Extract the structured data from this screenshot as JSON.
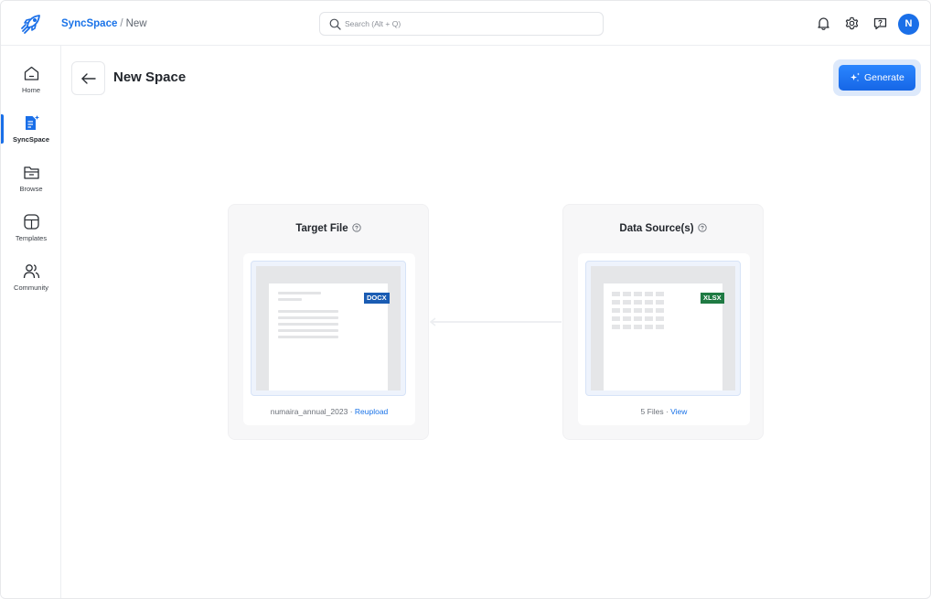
{
  "app": {
    "breadcrumb": {
      "root": "SyncSpace",
      "separator": "/",
      "current": "New"
    }
  },
  "search": {
    "placeholder": "Search (Alt + Q)"
  },
  "header_icons": [
    "bell-icon",
    "gear-icon",
    "help-icon"
  ],
  "user": {
    "initial": "N",
    "avatar_color": "#1a6fe8"
  },
  "sidebar": {
    "items": [
      {
        "label": "Home",
        "icon": "home-icon",
        "active": false
      },
      {
        "label": "SyncSpace",
        "icon": "syncspace-icon",
        "active": true
      },
      {
        "label": "Browse",
        "icon": "folder-icon",
        "active": false
      },
      {
        "label": "Templates",
        "icon": "templates-icon",
        "active": false
      },
      {
        "label": "Community",
        "icon": "community-icon",
        "active": false
      }
    ]
  },
  "page": {
    "title": "New Space",
    "generate_label": "Generate"
  },
  "target_file": {
    "title": "Target File",
    "badge": "DOCX",
    "file_name": "numaira_annual_2023",
    "separator": " · ",
    "action": "Reupload"
  },
  "data_sources": {
    "title": "Data Source(s)",
    "badge": "XLSX",
    "count_text": "5 Files",
    "separator": " · ",
    "action": "View"
  },
  "colors": {
    "accent": "#1a73e8",
    "docx": "#1a5cb3",
    "xlsx": "#1f7a43"
  }
}
